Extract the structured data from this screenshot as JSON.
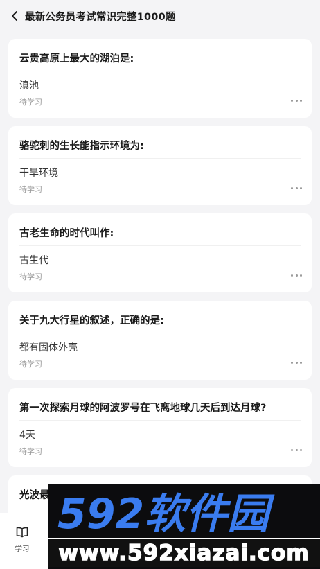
{
  "header": {
    "title": "最新公务员考试常识完整1000题"
  },
  "cards": [
    {
      "question": "云贵高原上最大的湖泊是:",
      "answer": "滇池",
      "status": "待学习"
    },
    {
      "question": "骆驼刺的生长能指示环境为:",
      "answer": "干旱环境",
      "status": "待学习"
    },
    {
      "question": "古老生命的时代叫作:",
      "answer": "古生代",
      "status": "待学习"
    },
    {
      "question": "关于九大行星的叙述，正确的是:",
      "answer": "都有固体外壳",
      "status": "待学习"
    },
    {
      "question": "第一次探索月球的阿波罗号在飞离地球几天后到达月球?",
      "answer": "4天",
      "status": "待学习"
    },
    {
      "question": "光波最"
    }
  ],
  "tabbar": {
    "study_label": "学习"
  },
  "watermark": {
    "logo": "592软件园",
    "url": "www.592xiazai.com"
  },
  "colors": {
    "background": "#f4f4f6",
    "card": "#ffffff",
    "watermark_bg": "#0c0c0e",
    "watermark_blue": "#3a7cf0"
  }
}
